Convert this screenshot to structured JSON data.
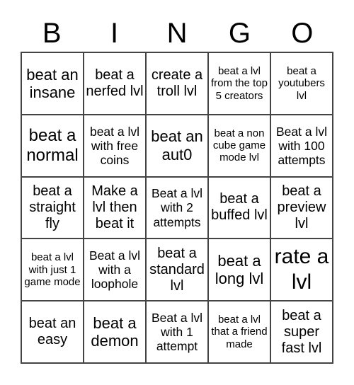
{
  "header": [
    "B",
    "I",
    "N",
    "G",
    "O"
  ],
  "cells": [
    "beat an insane",
    "beat a nerfed lvl",
    "create a troll lvl",
    "beat a lvl from the top 5 creators",
    "beat a youtubers lvl",
    "beat a normal",
    "beat a lvl with free coins",
    "beat an aut0",
    "beat a non cube game mode lvl",
    "Beat a lvl with 100 attempts",
    "beat a straight fly",
    "Make a lvl then beat it",
    "Beat a lvl with 2 attempts",
    "beat a buffed lvl",
    "beat a preview lvl",
    "beat a lvl with just 1 game mode",
    "Beat a lvl with a loophole",
    "beat a standard lvl",
    "beat a long lvl",
    "rate a lvl",
    "beat an easy",
    "beat a demon",
    "Beat a lvl with 1 attempt",
    "beat a lvl that a friend made",
    "beat a super fast lvl"
  ]
}
